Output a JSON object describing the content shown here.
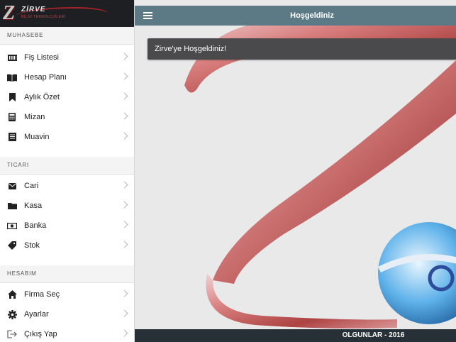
{
  "brand": {
    "name": "ZİRVE",
    "subtitle": "BİLGİ TEKNOLOJİLERİ"
  },
  "sidebar": {
    "sections": [
      {
        "title": "MUHASEBE",
        "items": [
          {
            "label": "Fiş Listesi",
            "icon": "barcode-icon"
          },
          {
            "label": "Hesap Planı",
            "icon": "book-icon"
          },
          {
            "label": "Aylık Özet",
            "icon": "bookmark-icon"
          },
          {
            "label": "Mizan",
            "icon": "calculator-icon"
          },
          {
            "label": "Muavin",
            "icon": "ledger-icon"
          }
        ]
      },
      {
        "title": "TICARI",
        "items": [
          {
            "label": "Cari",
            "icon": "envelope-icon"
          },
          {
            "label": "Kasa",
            "icon": "folder-icon"
          },
          {
            "label": "Banka",
            "icon": "money-icon"
          },
          {
            "label": "Stok",
            "icon": "tag-icon"
          }
        ]
      },
      {
        "title": "HESABIM",
        "items": [
          {
            "label": "Firma Seç",
            "icon": "home-icon"
          },
          {
            "label": "Ayarlar",
            "icon": "gear-icon"
          },
          {
            "label": "Çıkış Yap",
            "icon": "logout-icon"
          }
        ]
      }
    ]
  },
  "header": {
    "title": "Hoşgeldiniz",
    "menu_icon": "hamburger-icon"
  },
  "main": {
    "welcome_message": "Zirve'ye Hoşgeldiniz!"
  },
  "footer": {
    "text": "OLGUNLAR - 2016"
  },
  "colors": {
    "header_bg": "#5c7a86",
    "footer_bg": "#263036",
    "welcome_bg": "#4a4a4c",
    "logo_bg": "#1e1f22"
  }
}
